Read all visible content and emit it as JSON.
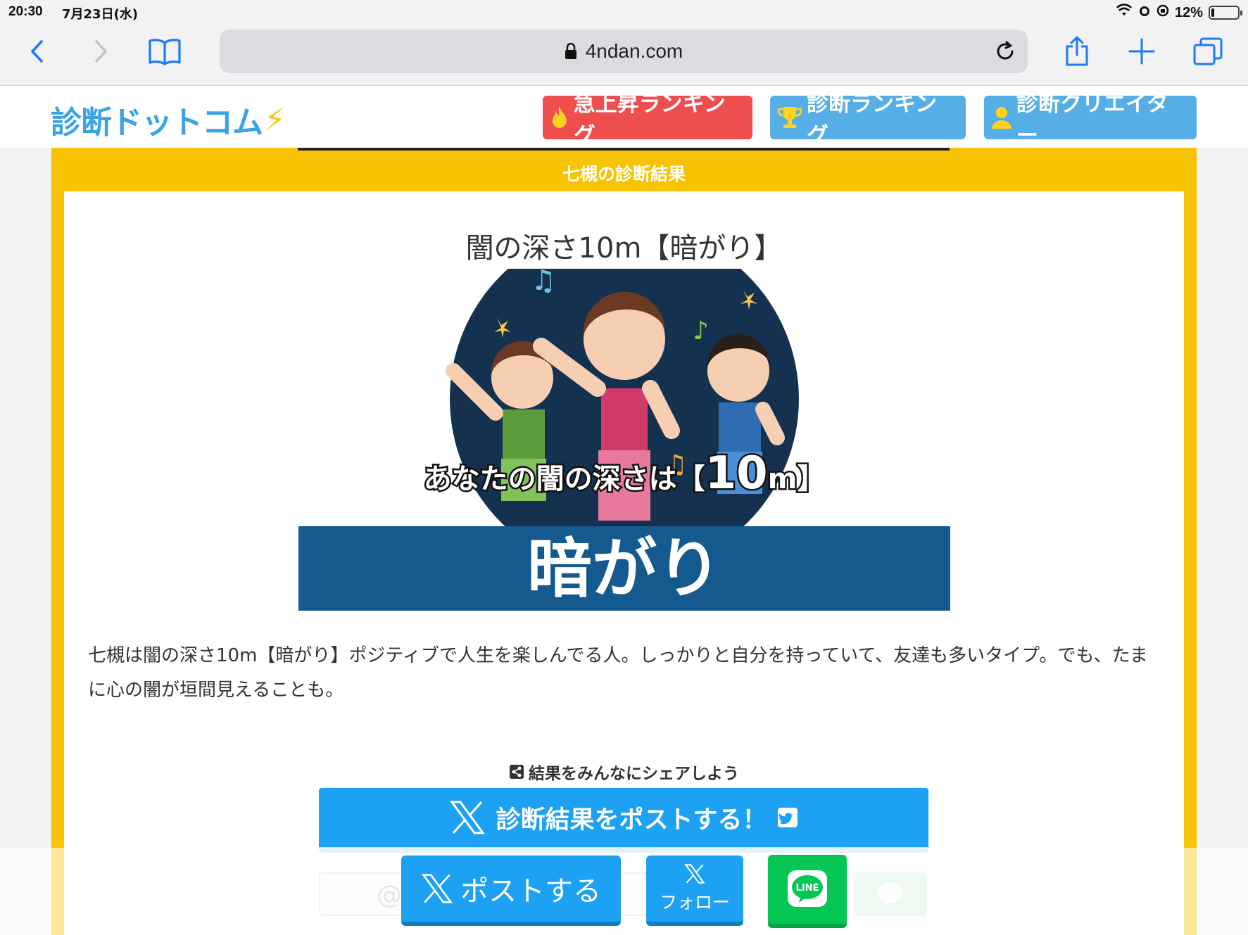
{
  "status_bar": {
    "time": "20:30",
    "date": "7月23日(水)",
    "battery": "12%",
    "battery_level": 0.12
  },
  "browser": {
    "url": "4ndan.com"
  },
  "site": {
    "logo_text": "診断ドットコム",
    "nav": [
      {
        "label": "急上昇ランキング",
        "icon": "flame-icon",
        "color": "#ef4e4e"
      },
      {
        "label": "診断ランキング",
        "icon": "trophy-icon",
        "color": "#56aee6"
      },
      {
        "label": "診断クリエイター",
        "icon": "person-icon",
        "color": "#56aee6"
      }
    ]
  },
  "result": {
    "section_title": "七槻の診断結果",
    "title": "闇の深さ10m【暗がり】",
    "image": {
      "caption_prefix": "あなたの闇の深さは【",
      "caption_value": "10",
      "caption_unit": "m】",
      "banner": "暗がり"
    },
    "description": "七槻は闇の深さ10m【暗がり】ポジティブで人生を楽しんでる人。しっかりと自分を持っていて、友達も多いタイプ。でも、たまに心の闇が垣間見えることも。"
  },
  "share": {
    "label": "結果をみんなにシェアしよう",
    "x_button": "診断結果をポストする！"
  },
  "bottom_bar": {
    "post_label": "ポストする",
    "follow_label": "フォロー",
    "line_label": "LINE"
  },
  "colors": {
    "frame_yellow": "#f7c302",
    "x_blue": "#1da1f2",
    "line_green": "#06c755",
    "logo_blue": "#3aa3e3",
    "banner_navy": "#145a8f"
  }
}
